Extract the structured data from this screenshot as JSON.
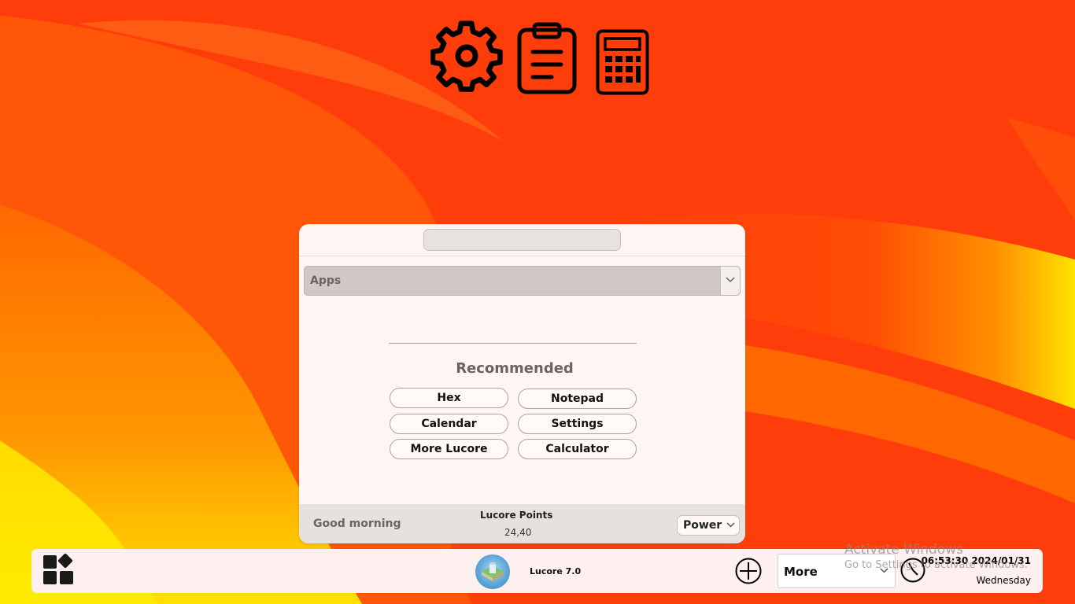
{
  "colors": {
    "wallpaper_base": "#ff3d0a",
    "wallpaper_orange": "#ff6a00",
    "wallpaper_yellow": "#ffd400",
    "panel_bg": "#fff6f3",
    "taskbar_bg": "#fdf0ee"
  },
  "desktop": {
    "icons": [
      {
        "name": "gear-icon"
      },
      {
        "name": "clipboard-icon"
      },
      {
        "name": "calculator-icon"
      }
    ]
  },
  "start_panel": {
    "search_placeholder": "",
    "apps_dropdown": {
      "selected": "Apps"
    },
    "recommended": {
      "title": "Recommended",
      "apps": [
        "Hex",
        "Notepad",
        "Calendar",
        "Settings",
        "More Lucore",
        "Calculator"
      ]
    },
    "footer": {
      "greeting": "Good morning",
      "points_title": "Lucore Points",
      "points_value": "24,40",
      "power_label": "Power"
    }
  },
  "taskbar": {
    "app_name": "Lucore 7.0",
    "more_label": "More",
    "time_date": "06:53:30 2024/01/31",
    "weekday": "Wednesday"
  },
  "watermark": {
    "title": "Activate Windows",
    "subtitle": "Go to Settings to activate Windows."
  }
}
